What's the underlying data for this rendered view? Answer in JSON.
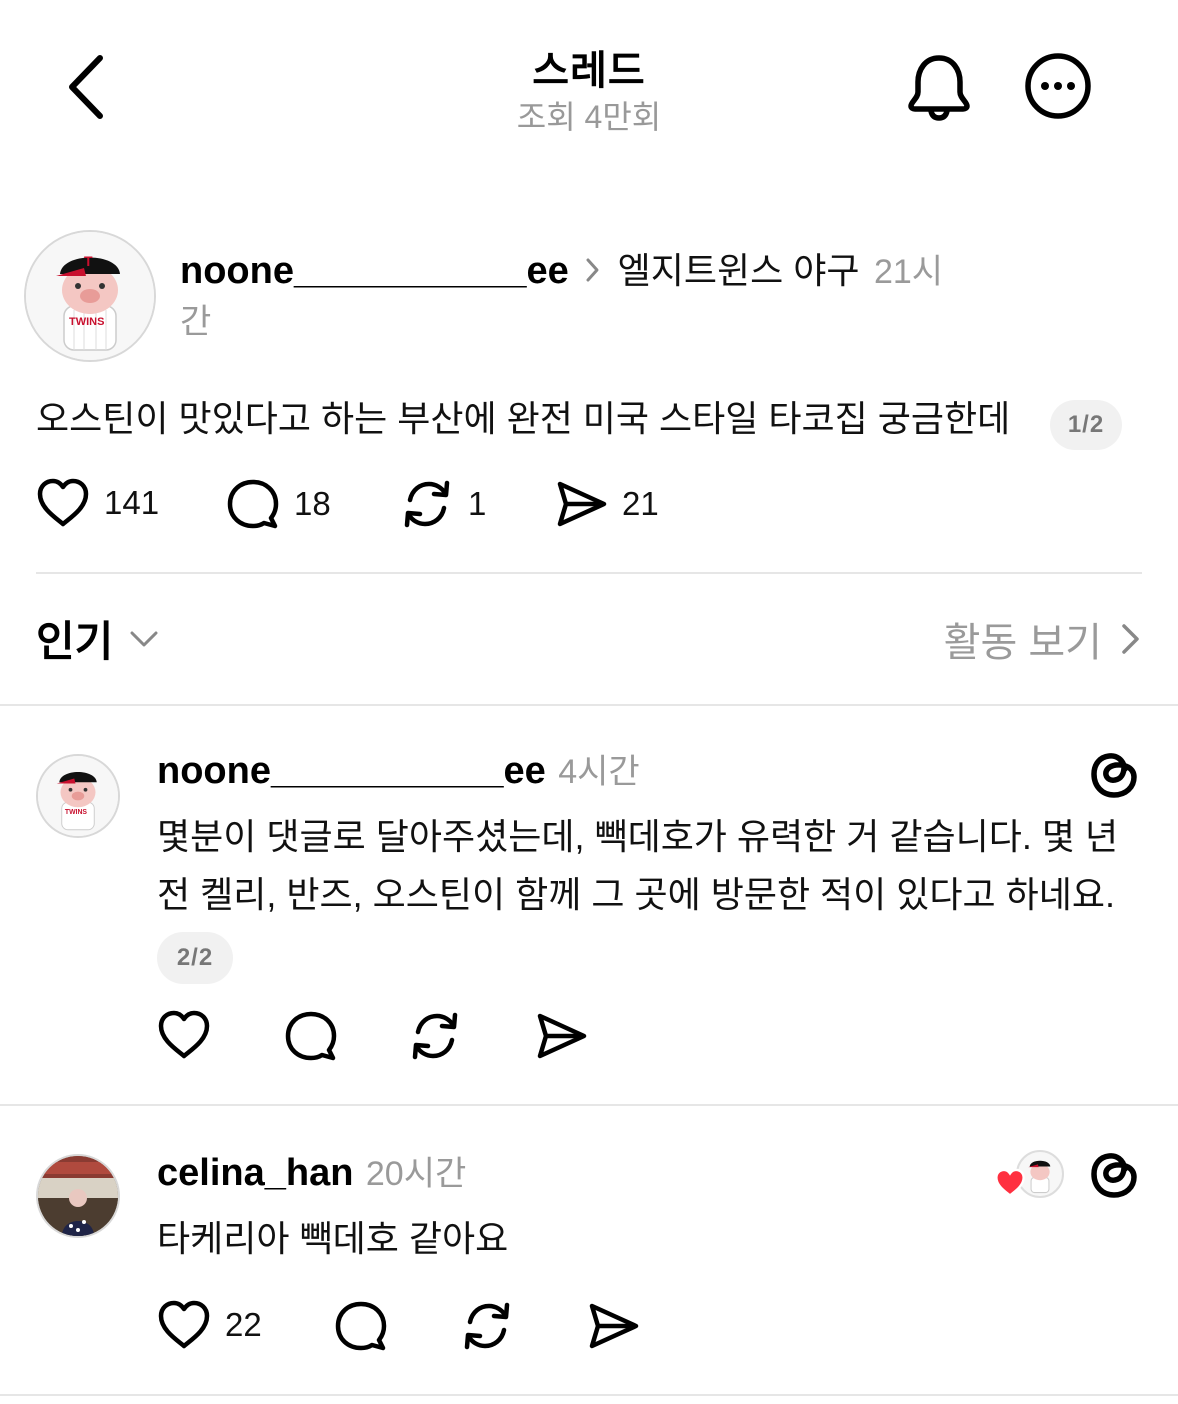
{
  "header": {
    "title": "스레드",
    "views": "조회 4만회"
  },
  "post": {
    "username": "noone___________ee",
    "community": "엘지트윈스 야구",
    "time_part1": "21시",
    "time_part2": "간",
    "text": "오스틴이 맛있다고 하는 부산에 완전 미국 스타일 타코집 궁금한데",
    "page_indicator": "1/2",
    "likes": "141",
    "replies": "18",
    "reposts": "1",
    "shares": "21"
  },
  "sort": {
    "label": "인기",
    "activity_label": "활동 보기"
  },
  "comments": [
    {
      "username": "noone___________ee",
      "time": "4시간",
      "text_line1": "몇분이 댓글로 달아주셨는데, 빽데호가 유력한 거 같습니다. 몇 년",
      "text_line2": "전 켈리, 반즈, 오스틴이 함께 그 곳에 방문한 적이 있다고 하네요.",
      "page_indicator": "2/2"
    },
    {
      "username": "celina_han",
      "time": "20시간",
      "text": "타케리아 빽데호 같아요",
      "likes": "22"
    }
  ],
  "colors": {
    "heart_red": "#ff3040",
    "text_gray": "#9a9a9a",
    "divider": "#e6e6e6"
  },
  "icons": [
    "back-chevron-icon",
    "bell-icon",
    "more-icon",
    "heart-icon",
    "comment-icon",
    "repost-icon",
    "share-icon",
    "threads-logo-icon",
    "chevron-down-icon",
    "chevron-right-icon"
  ]
}
